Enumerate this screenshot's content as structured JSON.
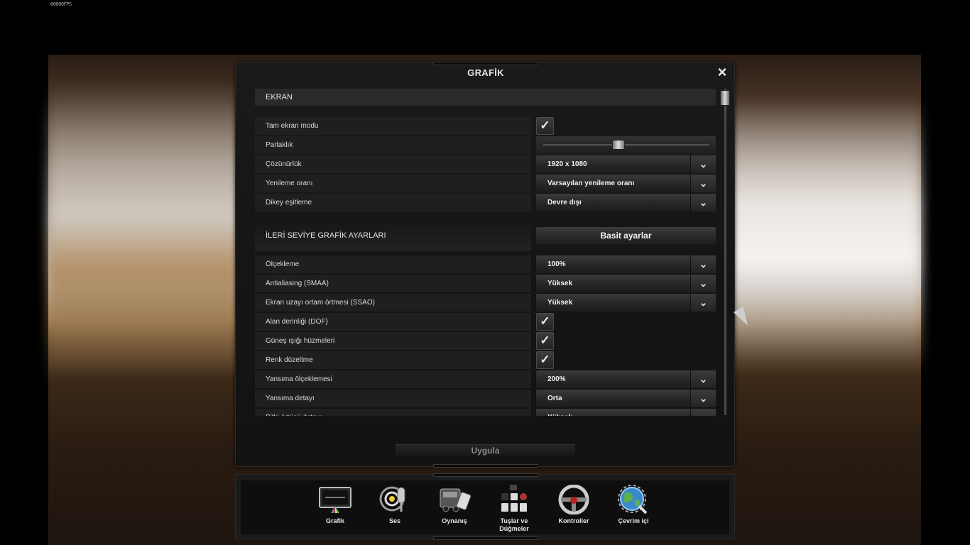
{
  "hud": {
    "fps_text": "00000FPS"
  },
  "dialog": {
    "title": "GRAFİK",
    "close_icon": "×",
    "section_screen": "EKRAN",
    "section_advanced": "İLERİ SEVİYE GRAFİK AYARLARI",
    "simple_settings_button": "Basit ayarlar",
    "apply_button": "Uygula",
    "screen_rows": [
      {
        "label": "Tam ekran modu",
        "type": "checkbox",
        "checked": true
      },
      {
        "label": "Parlaklık",
        "type": "slider",
        "value": 0.45
      },
      {
        "label": "Çözünürlük",
        "type": "dropdown",
        "value": "1920 x 1080"
      },
      {
        "label": "Yenileme oranı",
        "type": "dropdown",
        "value": "Varsayılan yenileme oranı"
      },
      {
        "label": "Dikey eşitleme",
        "type": "dropdown",
        "value": "Devre dışı"
      }
    ],
    "advanced_rows": [
      {
        "label": "Ölçekleme",
        "type": "dropdown",
        "value": "100%"
      },
      {
        "label": "Antialiasing (SMAA)",
        "type": "dropdown",
        "value": "Yüksek"
      },
      {
        "label": "Ekran uzayı ortam örtmesi (SSAO)",
        "type": "dropdown",
        "value": "Yüksek"
      },
      {
        "label": "Alan derinliği (DOF)",
        "type": "checkbox",
        "checked": true
      },
      {
        "label": "Güneş ışığı hüzmeleri",
        "type": "checkbox",
        "checked": true
      },
      {
        "label": "Renk düzeltme",
        "type": "checkbox",
        "checked": true
      },
      {
        "label": "Yansıma ölçeklemesi",
        "type": "dropdown",
        "value": "200%"
      },
      {
        "label": "Yansıma detayı",
        "type": "dropdown",
        "value": "Orta"
      },
      {
        "label": "Bitki örtüsü detayı",
        "type": "dropdown",
        "value": "Yüksek"
      }
    ],
    "checkmark_glyph": "✓",
    "dropdown_arrow_glyph": "⌄"
  },
  "nav": {
    "items": [
      {
        "label": "Grafik",
        "icon": "monitor-icon"
      },
      {
        "label": "Ses",
        "icon": "microphone-icon"
      },
      {
        "label": "Oynanış",
        "icon": "truck-icon"
      },
      {
        "label": "Tuşlar ve Düğmeler",
        "icon": "keyboard-icon"
      },
      {
        "label": "Kontroller",
        "icon": "steering-wheel-icon"
      },
      {
        "label": "Çevrim içi",
        "icon": "globe-icon"
      }
    ]
  }
}
